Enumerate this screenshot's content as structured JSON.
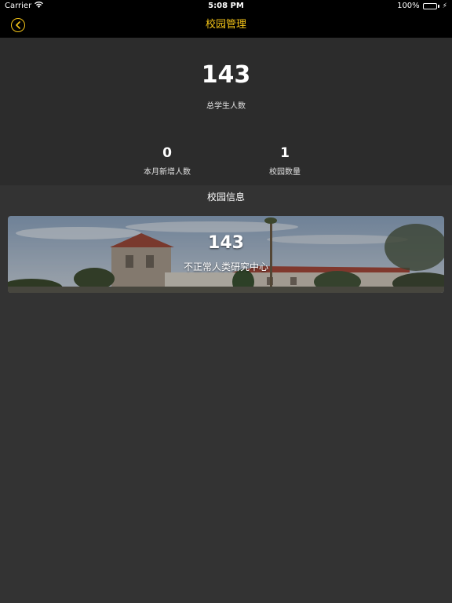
{
  "status_bar": {
    "carrier": "Carrier",
    "time": "5:08 PM",
    "battery": "100%",
    "icons": [
      "wifi-icon",
      "battery-icon",
      "charging-icon"
    ]
  },
  "nav": {
    "title": "校园管理",
    "back_icon": "chevron-left-circle-icon",
    "accent_color": "#f5c518"
  },
  "stats": {
    "total_students": "143",
    "total_students_label": "总学生人数",
    "new_this_month": "0",
    "new_this_month_label": "本月新增人数",
    "campus_count": "1",
    "campus_count_label": "校园数量"
  },
  "section": {
    "title": "校园信息"
  },
  "campuses": [
    {
      "count": "143",
      "name": "不正常人类研究中心"
    }
  ],
  "colors": {
    "background": "#333333",
    "panel": "#2c2c2c",
    "bar": "#000000",
    "battery_fill": "#3bd35a"
  }
}
